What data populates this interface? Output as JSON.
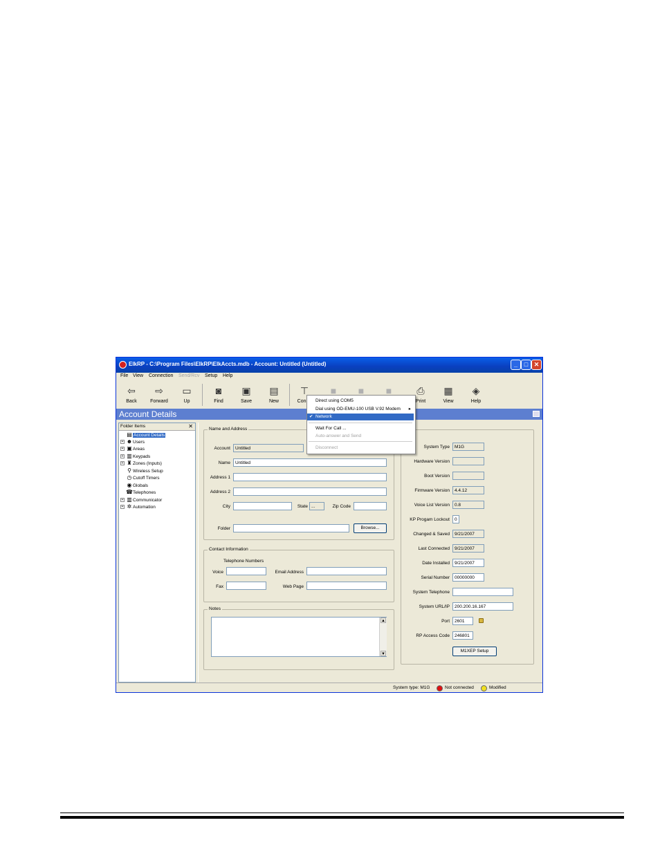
{
  "window": {
    "title": "ElkRP - C:\\Program Files\\ElkRP\\ElkAccts.mdb - Account: Untitled (Untitled)",
    "minimize": "_",
    "maximize": "□",
    "close": "✕"
  },
  "menu": {
    "file": "File",
    "view": "View",
    "connection": "Connection",
    "sendrecv": "Send/Rcv",
    "setup": "Setup",
    "help": "Help"
  },
  "toolbar": {
    "back": "Back",
    "forward": "Forward",
    "up": "Up",
    "find": "Find",
    "save": "Save",
    "new": "New",
    "connect": "Conne",
    "print": "Print",
    "view": "View",
    "help": "Help"
  },
  "header": {
    "title": "Account Details"
  },
  "tree": {
    "header": "Folder Items",
    "close": "✕",
    "items": [
      {
        "label": "Account Details",
        "icon": "account-details-icon"
      },
      {
        "label": "Users",
        "icon": "users-icon"
      },
      {
        "label": "Areas",
        "icon": "areas-icon"
      },
      {
        "label": "Keypads",
        "icon": "keypads-icon"
      },
      {
        "label": "Zones (Inputs)",
        "icon": "zones-icon"
      },
      {
        "label": "Wireless Setup",
        "icon": "wireless-icon"
      },
      {
        "label": "Cutoff Timers",
        "icon": "timer-icon"
      },
      {
        "label": "Globals",
        "icon": "globe-icon"
      },
      {
        "label": "Telephones",
        "icon": "telephone-icon"
      },
      {
        "label": "Communicator",
        "icon": "communicator-icon"
      },
      {
        "label": "Automation",
        "icon": "automation-icon"
      }
    ]
  },
  "name_address": {
    "legend": "Name and Address",
    "account_label": "Account",
    "account_value": "Untitled",
    "name_label": "Name",
    "name_value": "Untitled",
    "address1_label": "Address 1",
    "address1_value": "",
    "address2_label": "Address 2",
    "address2_value": "",
    "city_label": "City",
    "city_value": "",
    "state_label": "State",
    "state_value": "...",
    "zip_label": "Zip Code",
    "zip_value": "",
    "folder_label": "Folder",
    "folder_value": "",
    "browse": "Browse..."
  },
  "contact": {
    "legend": "Contact Information",
    "phone_header": "Telephone Numbers",
    "voice_label": "Voice",
    "voice_value": "",
    "fax_label": "Fax",
    "fax_value": "",
    "email_label": "Email Address",
    "email_value": "",
    "web_label": "Web Page",
    "web_value": ""
  },
  "notes": {
    "legend": "Notes",
    "value": ""
  },
  "system": {
    "legend": "em",
    "system_type_label": "System Type",
    "system_type": "M1G",
    "hardware_label": "Hardware Version",
    "hardware": "",
    "boot_label": "Boot Version",
    "boot": "",
    "firmware_label": "Firmware Version",
    "firmware": "4.4.12",
    "voice_list_label": "Voice List Version",
    "voice_list": "0.8",
    "kp_lockout_label": "KP Progam Lockout",
    "kp_lockout": "0",
    "changed_label": "Changed & Saved",
    "changed": "9/21/2007",
    "last_connected_label": "Last Connected",
    "last_connected": "9/21/2007",
    "date_installed_label": "Date Installed",
    "date_installed": "9/21/2007",
    "serial_label": "Serial Number",
    "serial": "00000000",
    "sys_phone_label": "System Telephone",
    "sys_phone": "",
    "url_label": "System URL/IP",
    "url": "200.200.16.167",
    "port_label": "Port",
    "port": "2601",
    "access_label": "RP Access Code",
    "access": "246801",
    "m1xep_button": "M1XEP Setup"
  },
  "connection_menu": {
    "items": [
      {
        "label": "Direct using COM5",
        "state": "normal"
      },
      {
        "label": "Dial using OD-EMU-100 USB V.92 Modem",
        "state": "submenu"
      },
      {
        "label": "Network",
        "state": "checked"
      },
      {
        "label": "Wait For Call ...",
        "state": "normal"
      },
      {
        "label": "Auto-answer and Send",
        "state": "disabled"
      },
      {
        "label": "Disconnect",
        "state": "disabled"
      }
    ],
    "check": "✔",
    "arrow": "▸"
  },
  "status": {
    "system_type": "System type: M1G",
    "connection": "Not connected",
    "modified": "Modified"
  },
  "colors": {
    "titlebar": "#0a3fbf",
    "header": "#5d7fd0",
    "selection": "#316ac5",
    "not_connected": "#e01010",
    "modified": "#f0e020"
  }
}
